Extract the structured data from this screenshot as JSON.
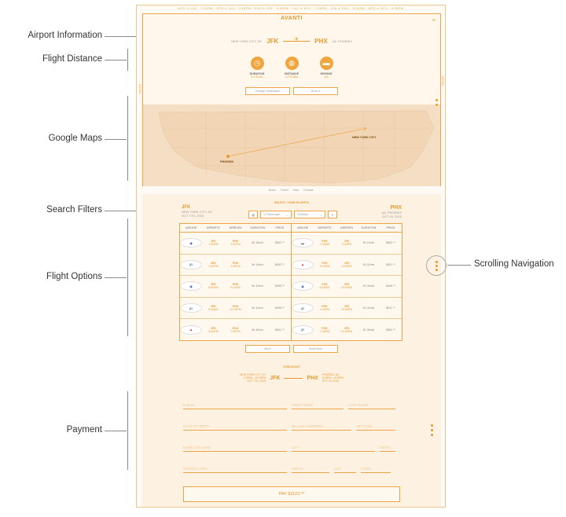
{
  "annotations": {
    "airport_information": "Airport Information",
    "flight_distance": "Flight Distance",
    "google_maps": "Google Maps",
    "search_filters": "Search Filters",
    "flight_options": "Flight  Options",
    "payment": "Payment",
    "scrolling_navigation": "Scrolling Navigation"
  },
  "ticker": "NYC ✈ LAX · 3:30PM · SFO ✈ LAX · 4:15PM · PHX ✈ JFK · 5:40PM · LAX ✈ NYC · 7:25PM · JFK ✈ PHX · 8:10PM · BOS ✈ SFO · 9:35PM",
  "header": {
    "logo": "AVANTI",
    "close": "×",
    "from_city": "NEW YORK CITY, NY",
    "from_code": "JFK",
    "to_code": "PHX",
    "to_city": "AZ, PHOENIX"
  },
  "stats": [
    {
      "icon": "clock-icon",
      "glyph": "◷",
      "label": "DURATION",
      "value": "5 h 45 min"
    },
    {
      "icon": "globe-icon",
      "glyph": "◍",
      "label": "DISTANCE",
      "value": "2,075 miles"
    },
    {
      "icon": "car-icon",
      "glyph": "▬",
      "label": "DRIVING",
      "value": "N/A"
    }
  ],
  "buttons": {
    "change_destination": "Change Destination",
    "book_it": "Book it"
  },
  "map": {
    "label_nyc": "NEW YORK CITY",
    "label_phx": "PHOENIX"
  },
  "footer_links": [
    "Deals",
    "Travel",
    "Help",
    "Contact"
  ],
  "select": {
    "heading": "SELECT YOUR FLIGHTS",
    "from_code": "JFK",
    "from_city": "NEW YORK CITY, NY",
    "from_date": "OCT 7TH, 2015",
    "to_code": "PHX",
    "to_city": "AZ, PHOENIX",
    "to_date": "OCT 15, 2015",
    "passenger": "1 Passenger",
    "trip": "Nonstop"
  },
  "table": {
    "headers": [
      "AIRLINE",
      "DEPARTS",
      "ARRIVES",
      "DURATION",
      "PRICE"
    ],
    "outbound": [
      {
        "airline": "united",
        "dep_code": "JFK",
        "dep_time": "1:30PM",
        "arr_code": "PHX",
        "arr_time": "3:40PM",
        "duration": "5h 16min",
        "price": "$561.⁰⁰"
      },
      {
        "airline": "jetblue",
        "dep_code": "JFK",
        "dep_time": "1:20PM",
        "arr_code": "PHX",
        "arr_time": "3:40PM",
        "duration": "5h 34min",
        "price": "$592.⁰⁰"
      },
      {
        "airline": "united",
        "dep_code": "JFK",
        "dep_time": "6:00AM",
        "arr_code": "PHX",
        "arr_time": "9:14AM",
        "duration": "5h 34min",
        "price": "$485.⁰⁰"
      },
      {
        "airline": "jetblue",
        "dep_code": "JFK",
        "dep_time": "9:04AM",
        "arr_code": "PHX",
        "arr_time": "12:33PM",
        "duration": "5h 34min",
        "price": "$496.⁰⁰"
      },
      {
        "airline": "delta",
        "dep_code": "JFK",
        "dep_time": "4:20PM",
        "arr_code": "PHX",
        "arr_time": "7:09PM",
        "duration": "5h 40min",
        "price": "$561.⁰⁰"
      }
    ],
    "inbound": [
      {
        "airline": "us",
        "dep_code": "PHX",
        "dep_time": "7:05AM",
        "arr_code": "JFK",
        "arr_time": "3:40PM",
        "duration": "5h 15min",
        "price": "$563.⁰⁰"
      },
      {
        "airline": "delta",
        "dep_code": "PHX",
        "dep_time": "5:16PM",
        "arr_code": "JFK",
        "arr_time": "6:38PM",
        "duration": "5h 32min",
        "price": "$521.⁰⁰"
      },
      {
        "airline": "united",
        "dep_code": "PHX",
        "dep_time": "8:25AM",
        "arr_code": "JFK",
        "arr_time": "10:49AM",
        "duration": "5h 34min",
        "price": "$496.⁰⁰"
      },
      {
        "airline": "jetblue",
        "dep_code": "PHX",
        "dep_time": "4:30PM",
        "arr_code": "JFK",
        "arr_time": "10:52PM",
        "duration": "5h 34min",
        "price": "$511.⁰⁰"
      },
      {
        "airline": "jetblue",
        "dep_code": "PHX",
        "dep_time": "7:40PM",
        "arr_code": "JFK",
        "arr_time": "10:50PM",
        "duration": "5h 35min",
        "price": "$563.⁰⁰"
      }
    ]
  },
  "table_buttons": {
    "more": "More",
    "book_now": "Book Now"
  },
  "checkout": {
    "heading": "CHECKOUT",
    "from_city": "NEW YORK CITY, NY",
    "from_detail": "1:30PM – 10:20PM",
    "from_date": "OCT 7TH, 2015",
    "from_code": "JFK",
    "to_code": "PHX",
    "to_city": "PHOENIX, AZ",
    "to_detail": "8:25PM – 6:38PM",
    "to_date": "OCT 15, 2015"
  },
  "payment": {
    "email": "E-MAIL",
    "first_name": "FIRST NAME",
    "last_name": "LAST NAME",
    "birth": "DATE OF BIRTH",
    "address": "BILLING ADDRESS",
    "zip": "ZIP CODE",
    "card_name": "NAME ON CARD",
    "city": "CITY",
    "state": "STATE",
    "card_number": "CREDIT CARD",
    "exp": "MM/YY",
    "cvv": "CVV",
    "code": "CODE",
    "pay_button": "PAY $1123.⁰⁰"
  }
}
